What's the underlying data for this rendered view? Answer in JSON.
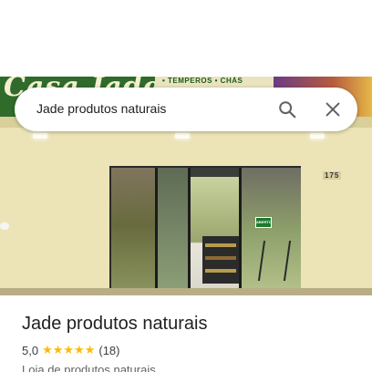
{
  "search": {
    "query": "Jade produtos naturais",
    "search_icon": "search-icon",
    "close_icon": "close-icon"
  },
  "photo": {
    "sign_brand": "Casa Jade",
    "sign_panel_text": "• TEMPEROS • CHÁS",
    "door_sign": "ABERTO",
    "house_number": "175"
  },
  "place": {
    "title": "Jade produtos naturais",
    "rating": "5,0",
    "stars": 5,
    "review_count": "(18)",
    "category": "Loja de produtos naturais"
  },
  "colors": {
    "star": "#fbbc04",
    "sign_green": "#2f6b2a",
    "wall": "#ece4b7"
  }
}
